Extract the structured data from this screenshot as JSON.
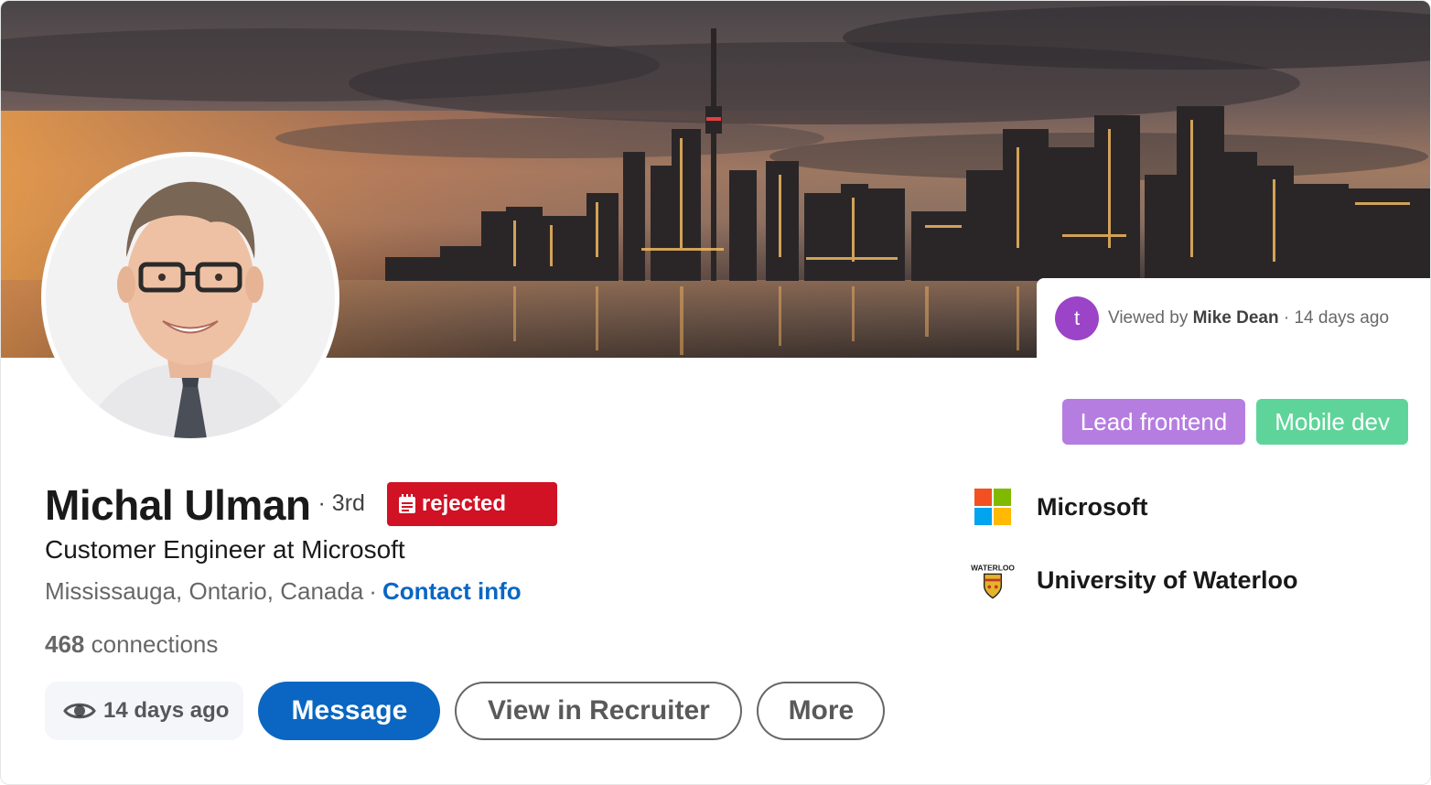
{
  "banner": {
    "description_icon": "toronto-skyline-banner"
  },
  "viewed_by": {
    "avatar_letter": "t",
    "avatar_color": "#9b44c7",
    "prefix": "Viewed by",
    "name": "Mike Dean",
    "separator": "·",
    "time": "14 days ago"
  },
  "tags": [
    {
      "label": "Lead frontend",
      "color": "#b57de0"
    },
    {
      "label": "Mobile dev",
      "color": "#5fd49a"
    }
  ],
  "profile": {
    "name": "Michal Ulman",
    "degree": "· 3rd",
    "status": {
      "label": "rejected",
      "color": "#d11124",
      "icon": "notepad-icon"
    },
    "headline": "Customer Engineer at Microsoft",
    "location": "Mississauga, Ontario, Canada",
    "separator": "·",
    "contact_label": "Contact info",
    "connections_count": "468",
    "connections_label": "connections"
  },
  "actions": {
    "viewed_icon": "eye-icon",
    "viewed_time": "14 days ago",
    "message": "Message",
    "recruiter": "View in Recruiter",
    "more": "More"
  },
  "orgs": [
    {
      "name": "Microsoft",
      "logo": "microsoft-logo"
    },
    {
      "name": "University of Waterloo",
      "logo": "waterloo-logo",
      "logo_text": "WATERLOO"
    }
  ],
  "colors": {
    "accent": "#0a66c2",
    "status_rejected": "#d11124"
  }
}
